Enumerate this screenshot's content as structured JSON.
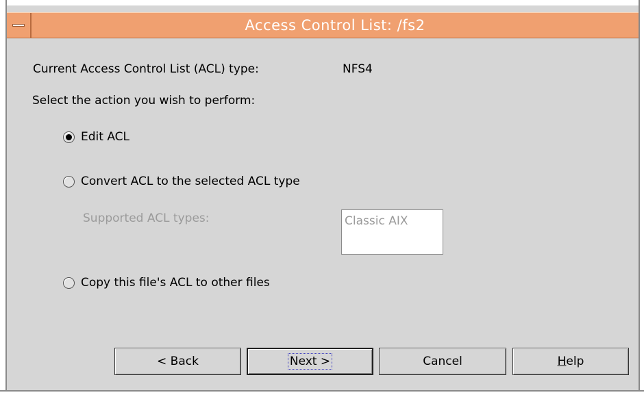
{
  "window": {
    "title": "Access Control List: /fs2",
    "title_bar_color": "#f0a070",
    "menu_icon": "window-menu-icon"
  },
  "content": {
    "acl_type_label": "Current Access Control List (ACL) type:",
    "acl_type_value": "NFS4",
    "select_action_label": "Select the action you wish to perform:",
    "options": [
      {
        "label": "Edit ACL",
        "checked": true
      },
      {
        "label": "Convert ACL to the selected ACL type",
        "checked": false
      },
      {
        "label": "Copy this file's ACL to other files",
        "checked": false
      }
    ],
    "supported_types_label": "Supported ACL types:",
    "supported_types": [
      "Classic AIX"
    ]
  },
  "buttons": {
    "back": "< Back",
    "next": "Next >",
    "cancel": "Cancel",
    "help_mnemonic": "H",
    "help_rest": "elp"
  }
}
